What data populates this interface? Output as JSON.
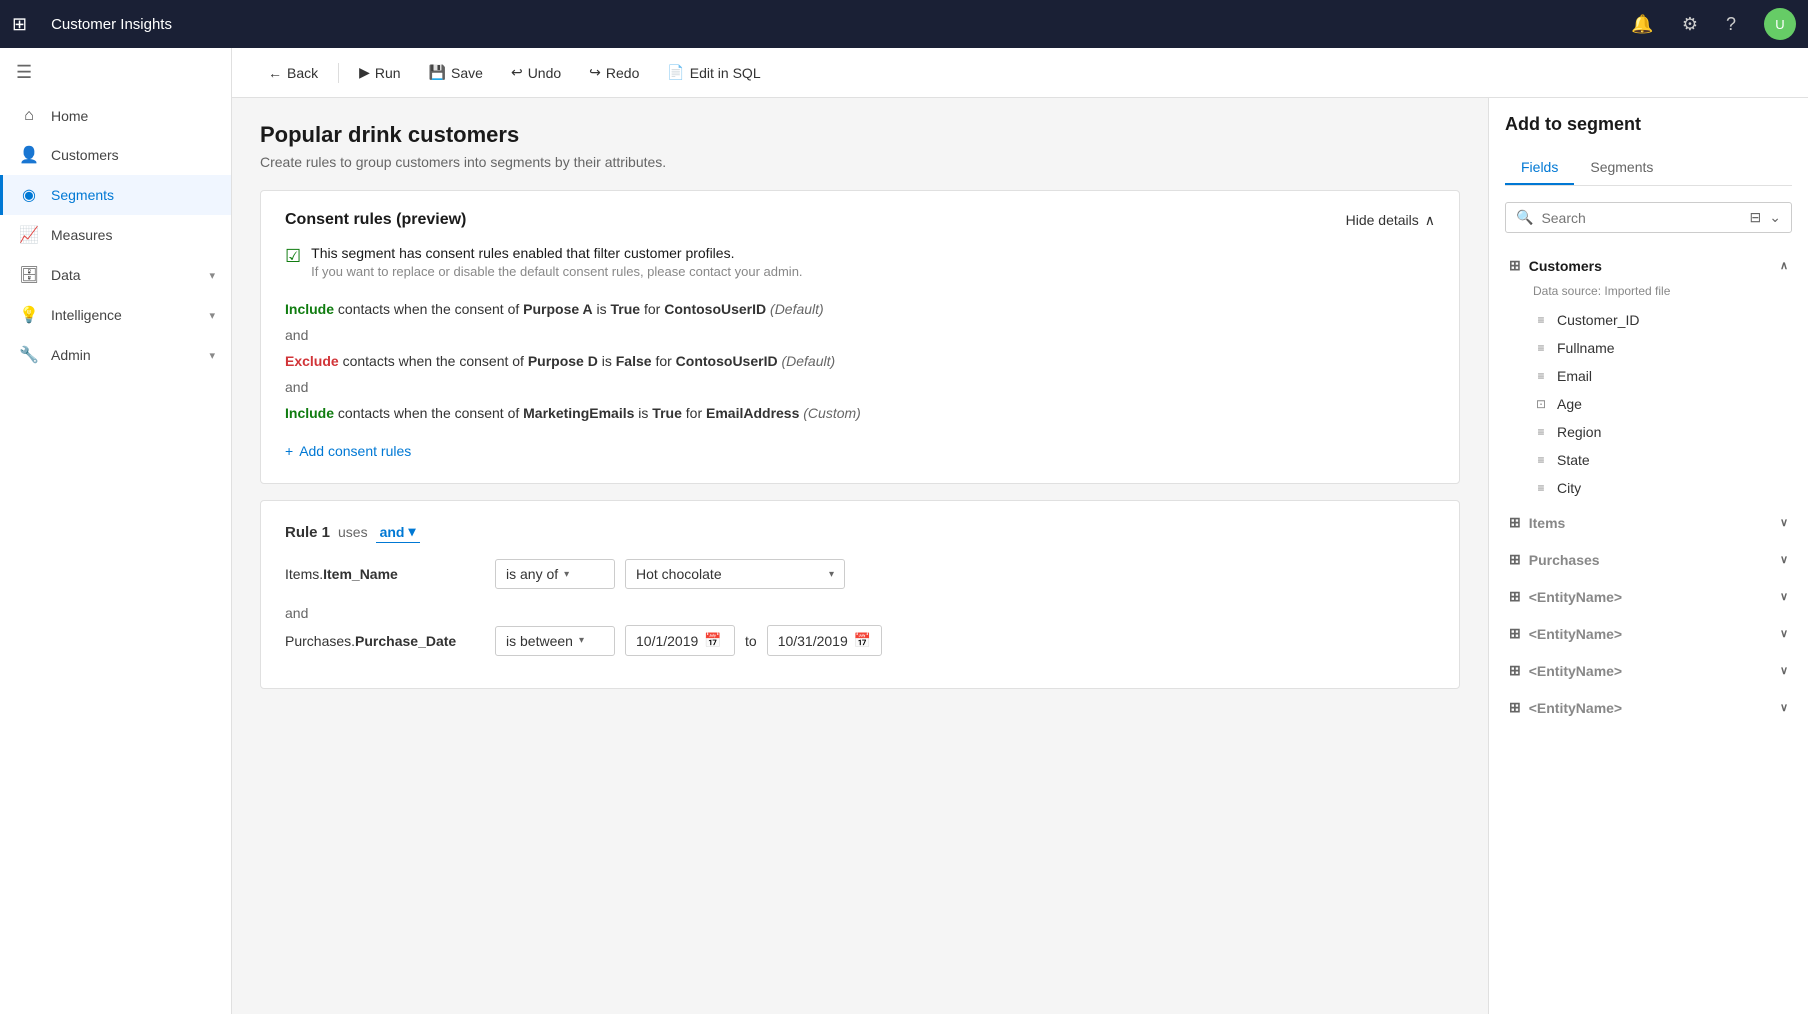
{
  "app": {
    "title": "Customer Insights",
    "grid_icon": "⊞"
  },
  "topbar": {
    "icons": {
      "notification": "🔔",
      "settings": "⚙",
      "help": "?"
    },
    "avatar_text": "U"
  },
  "sidebar": {
    "toggle_icon": "☰",
    "items": [
      {
        "id": "home",
        "label": "Home",
        "icon": "⌂",
        "active": false
      },
      {
        "id": "customers",
        "label": "Customers",
        "icon": "👤",
        "active": false,
        "expand": false
      },
      {
        "id": "segments",
        "label": "Segments",
        "icon": "◉",
        "active": true
      },
      {
        "id": "measures",
        "label": "Measures",
        "icon": "📈",
        "active": false
      },
      {
        "id": "data",
        "label": "Data",
        "icon": "🗄",
        "active": false,
        "expand": true
      },
      {
        "id": "intelligence",
        "label": "Intelligence",
        "icon": "💡",
        "active": false,
        "expand": true
      },
      {
        "id": "admin",
        "label": "Admin",
        "icon": "🔧",
        "active": false,
        "expand": true
      }
    ]
  },
  "toolbar": {
    "back_label": "Back",
    "run_label": "Run",
    "save_label": "Save",
    "undo_label": "Undo",
    "redo_label": "Redo",
    "edit_sql_label": "Edit in SQL"
  },
  "page": {
    "title": "Popular drink customers",
    "subtitle": "Create rules to group customers into segments by their attributes."
  },
  "consent_rules": {
    "section_title": "Consent rules (preview)",
    "hide_details_label": "Hide details",
    "notice_main": "This segment has consent rules enabled that filter customer profiles.",
    "notice_sub": "If you want to replace or disable the default consent rules, please contact your admin.",
    "rules": [
      {
        "type": "include",
        "keyword": "Include",
        "text_parts": [
          "contacts when the consent of ",
          "Purpose A",
          " is ",
          "True",
          " for ",
          "ContosoUserID",
          " ",
          "(Default)"
        ]
      },
      {
        "type": "exclude",
        "keyword": "Exclude",
        "text_parts": [
          "contacts when the consent of ",
          "Purpose D",
          " is ",
          "False",
          " for ",
          "ContosoUserID",
          " ",
          "(Default)"
        ]
      },
      {
        "type": "include",
        "keyword": "Include",
        "text_parts": [
          "contacts when the consent of ",
          "MarketingEmails",
          " is ",
          "True",
          " for ",
          "EmailAddress",
          " ",
          "(Custom)"
        ]
      }
    ],
    "add_consent_label": "Add consent rules"
  },
  "rule1": {
    "label": "Rule 1",
    "uses_label": "uses",
    "operator": "and",
    "rows": [
      {
        "field_entity": "Items.",
        "field_name": "Item_Name",
        "condition": "is any of",
        "value": "Hot chocolate",
        "type": "dropdown"
      },
      {
        "field_entity": "Purchases.",
        "field_name": "Purchase_Date",
        "condition": "is between",
        "date_from": "10/1/2019",
        "date_to": "10/31/2019",
        "type": "daterange"
      }
    ],
    "and_text": "and"
  },
  "right_panel": {
    "title": "Add to segment",
    "tabs": [
      {
        "id": "fields",
        "label": "Fields",
        "active": true
      },
      {
        "id": "segments",
        "label": "Segments",
        "active": false
      }
    ],
    "search_placeholder": "Search",
    "entities": [
      {
        "id": "customers",
        "label": "Customers",
        "source": "Data source: Imported file",
        "expanded": true,
        "fields": [
          {
            "id": "customer_id",
            "label": "Customer_ID"
          },
          {
            "id": "fullname",
            "label": "Fullname"
          },
          {
            "id": "email",
            "label": "Email"
          },
          {
            "id": "age",
            "label": "Age"
          },
          {
            "id": "region",
            "label": "Region"
          },
          {
            "id": "state",
            "label": "State"
          },
          {
            "id": "city",
            "label": "City"
          }
        ]
      },
      {
        "id": "items",
        "label": "Items",
        "expanded": false,
        "fields": []
      },
      {
        "id": "purchases",
        "label": "Purchases",
        "expanded": false,
        "fields": []
      },
      {
        "id": "entity1",
        "label": "<EntityName>",
        "expanded": false,
        "fields": []
      },
      {
        "id": "entity2",
        "label": "<EntityName>",
        "expanded": false,
        "fields": []
      },
      {
        "id": "entity3",
        "label": "<EntityName>",
        "expanded": false,
        "fields": []
      },
      {
        "id": "entity4",
        "label": "<EntityName>",
        "expanded": false,
        "fields": []
      }
    ]
  }
}
